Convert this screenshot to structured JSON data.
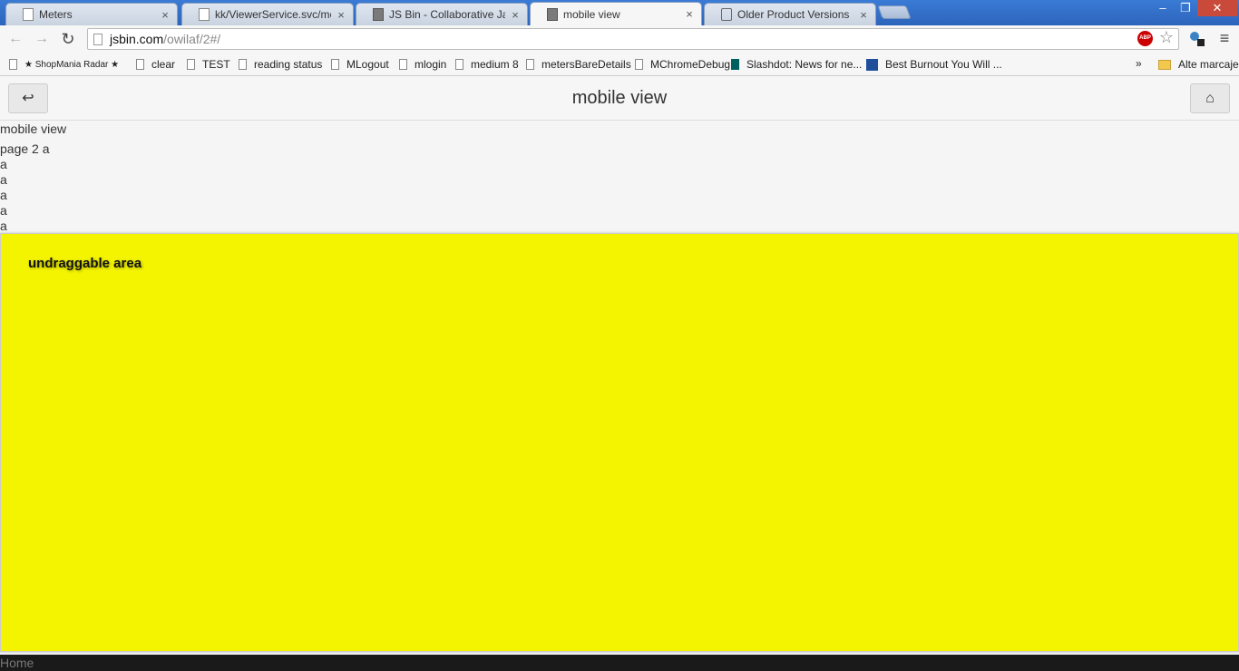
{
  "tabs": [
    {
      "title": "Meters",
      "active": false
    },
    {
      "title": "kk/ViewerService.svc/meters",
      "active": false
    },
    {
      "title": "JS Bin - Collaborative JavaSc",
      "active": false
    },
    {
      "title": "mobile view",
      "active": true
    },
    {
      "title": "Older Product Versions",
      "active": false
    }
  ],
  "tab_close_glyph": "×",
  "window_controls": {
    "minimize": "–",
    "restore": "❐",
    "close": "✕"
  },
  "toolbar": {
    "back_glyph": "←",
    "forward_glyph": "→",
    "reload_glyph": "↻",
    "url_host": "jsbin.com",
    "url_path": "/owilaf/2#/",
    "abp_label": "ABP",
    "star_glyph": "☆",
    "menu_glyph": "≡"
  },
  "bookmarks": [
    {
      "label": "★ ShopMania Radar ★",
      "icon": "page-icon"
    },
    {
      "label": "clear",
      "icon": "page-icon"
    },
    {
      "label": "TEST",
      "icon": "page-icon"
    },
    {
      "label": "reading status",
      "icon": "page-icon"
    },
    {
      "label": "MLogout",
      "icon": "page-icon"
    },
    {
      "label": "mlogin",
      "icon": "page-icon"
    },
    {
      "label": "medium 8",
      "icon": "page-icon"
    },
    {
      "label": "metersBareDetails",
      "icon": "page-icon"
    },
    {
      "label": "MChromeDebug",
      "icon": "page-icon"
    },
    {
      "label": "Slashdot: News for ne...",
      "icon": "slashdot-icon"
    },
    {
      "label": "Best Burnout You Will ...",
      "icon": "k-icon"
    }
  ],
  "bookmarks_more": "»",
  "other_bookmarks": "Alte marcaje",
  "header": {
    "title": "mobile view",
    "back_glyph": "↩",
    "home_glyph": "⌂"
  },
  "content": {
    "title": "mobile view",
    "text": "page 2 a",
    "lines": [
      "a",
      "a",
      "a",
      "a",
      "a"
    ],
    "undraggable_label": "undraggable area"
  },
  "footer": {
    "label": "Home"
  },
  "colors": {
    "yellow_area": "#f4f400",
    "tabstrip": "#3a7bd5"
  }
}
